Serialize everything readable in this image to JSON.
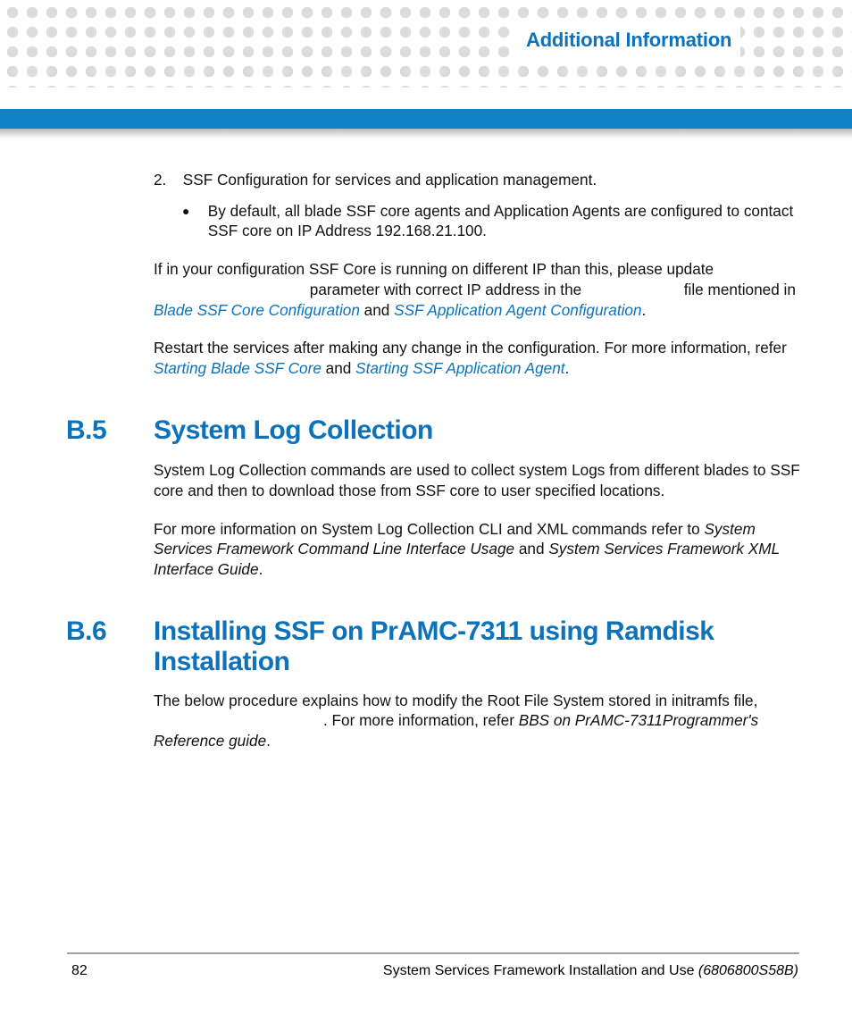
{
  "header": {
    "chapter_title": "Additional Information"
  },
  "body": {
    "item2_num": "2.",
    "item2_text": "SSF Configuration for services and application management.",
    "bullet1": "By default, all blade SSF core agents and Application Agents are configured to contact SSF core on IP Address 192.168.21.100.",
    "para1_a": "If in your configuration SSF Core is running on different IP than this, please update ",
    "para1_b": " parameter with correct IP address in the ",
    "para1_c": " file mentioned in ",
    "link_blade_cfg": "Blade SSF Core Configuration",
    "para1_and": " and ",
    "link_app_cfg": "SSF Application Agent Configuration",
    "para1_period": ".",
    "para2_a": "Restart the services after making any change in the configuration. For more information, refer ",
    "link_start_blade": "Starting Blade SSF Core",
    "para2_and": " and ",
    "link_start_app": "Starting SSF Application Agent",
    "para2_period": "."
  },
  "sec_b5": {
    "num": "B.5",
    "title": "System Log Collection",
    "p1": "System Log Collection commands are used to collect system Logs from different blades to SSF core and then to download those from SSF core to user specified locations.",
    "p2_a": "For more information on System Log Collection CLI and XML commands refer to ",
    "p2_ital1": "System Services Framework Command Line Interface Usage",
    "p2_mid": " and ",
    "p2_ital2": "System Services Framework XML Interface Guide",
    "p2_end": "."
  },
  "sec_b6": {
    "num": "B.6",
    "title": "Installing SSF on PrAMC-7311 using Ramdisk Installation",
    "p1_a": "The below procedure explains how to modify the Root File System stored in initramfs file, ",
    "p1_b": ". For more information, refer ",
    "p1_ital": "BBS on PrAMC-7311Programmer's Reference guide",
    "p1_end": "."
  },
  "footer": {
    "page": "82",
    "title": "System Services Framework Installation and Use ",
    "docid": "(6806800S58B)"
  }
}
